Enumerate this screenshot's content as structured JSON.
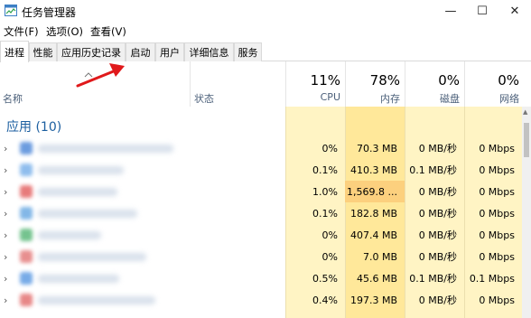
{
  "window": {
    "title": "任务管理器",
    "controls": {
      "minimize": "—",
      "maximize": "☐",
      "close": "✕"
    }
  },
  "menu": [
    "文件(F)",
    "选项(O)",
    "查看(V)"
  ],
  "tabs": [
    {
      "label": "进程",
      "active": true
    },
    {
      "label": "性能",
      "active": false
    },
    {
      "label": "应用历史记录",
      "active": false
    },
    {
      "label": "启动",
      "active": false
    },
    {
      "label": "用户",
      "active": false
    },
    {
      "label": "详细信息",
      "active": false
    },
    {
      "label": "服务",
      "active": false
    }
  ],
  "columns": {
    "name": "名称",
    "status": "状态",
    "cpu": {
      "percent": "11%",
      "label": "CPU"
    },
    "memory": {
      "percent": "78%",
      "label": "内存"
    },
    "disk": {
      "percent": "0%",
      "label": "磁盘"
    },
    "network": {
      "percent": "0%",
      "label": "网络"
    }
  },
  "group": {
    "title": "应用 (10)"
  },
  "rows": [
    {
      "cpu": "0%",
      "memory": "70.3 MB",
      "disk": "0 MB/秒",
      "network": "0 Mbps",
      "icon_color": "#3a7bd5"
    },
    {
      "cpu": "0.1%",
      "memory": "410.3 MB",
      "disk": "0.1 MB/秒",
      "network": "0 Mbps",
      "icon_color": "#6aa8e8"
    },
    {
      "cpu": "1.0%",
      "memory": "1,569.8 ...",
      "disk": "0 MB/秒",
      "network": "0 Mbps",
      "icon_color": "#e05050"
    },
    {
      "cpu": "0.1%",
      "memory": "182.8 MB",
      "disk": "0 MB/秒",
      "network": "0 Mbps",
      "icon_color": "#5aa0e0"
    },
    {
      "cpu": "0%",
      "memory": "407.4 MB",
      "disk": "0 MB/秒",
      "network": "0 Mbps",
      "icon_color": "#47b06a"
    },
    {
      "cpu": "0%",
      "memory": "7.0 MB",
      "disk": "0 MB/秒",
      "network": "0 Mbps",
      "icon_color": "#e06a6a"
    },
    {
      "cpu": "0.5%",
      "memory": "45.6 MB",
      "disk": "0.1 MB/秒",
      "network": "0.1 Mbps",
      "icon_color": "#4a8fe0"
    },
    {
      "cpu": "0.4%",
      "memory": "197.3 MB",
      "disk": "0 MB/秒",
      "network": "0 Mbps",
      "icon_color": "#e06060"
    }
  ],
  "colors": {
    "heat_light": "#fff4c4",
    "heat_mid": "#ffe89a",
    "heat_high": "#fcd07e",
    "group_title": "#1c5fa0",
    "annotation_red": "#e0191b"
  }
}
